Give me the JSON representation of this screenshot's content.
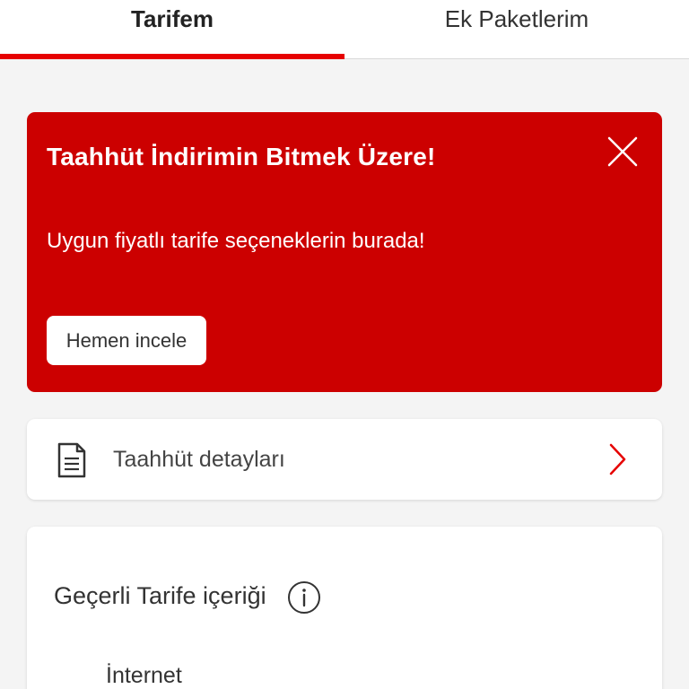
{
  "tabs": [
    {
      "label": "Tarifem",
      "active": true
    },
    {
      "label": "Ek Paketlerim",
      "active": false
    }
  ],
  "colors": {
    "accent": "#e60000",
    "banner_bg": "#cc0000",
    "page_bg": "#f4f4f4"
  },
  "promo": {
    "title": "Taahhüt İndirimin Bitmek Üzere!",
    "text": "Uygun fiyatlı tarife seçeneklerin burada!",
    "button_label": "Hemen incele",
    "close_icon": "close-icon"
  },
  "commitment": {
    "label": "Taahhüt detayları",
    "icon": "document-icon",
    "chevron": "chevron-right-icon"
  },
  "tariff": {
    "title": "Geçerli Tarife içeriği",
    "info_icon": "info-icon",
    "items": [
      {
        "label": "İnternet"
      }
    ]
  }
}
